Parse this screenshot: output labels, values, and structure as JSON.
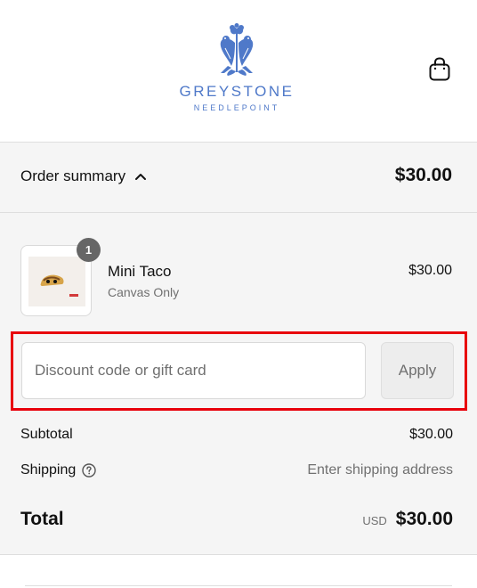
{
  "brand": {
    "name": "GREYSTONE",
    "subtitle": "NEEDLEPOINT",
    "color": "#4f79c9"
  },
  "header": {
    "cart_icon": "shopping-bag-icon"
  },
  "summary": {
    "toggle_label": "Order summary",
    "toggle_icon": "chevron-up-icon",
    "total": "$30.00"
  },
  "product": {
    "quantity": "1",
    "name": "Mini Taco",
    "variant": "Canvas Only",
    "price": "$30.00"
  },
  "discount": {
    "placeholder": "Discount code or gift card",
    "value": "",
    "apply_label": "Apply",
    "highlight_color": "#e8000b"
  },
  "totals": {
    "subtotal_label": "Subtotal",
    "subtotal_value": "$30.00",
    "shipping_label": "Shipping",
    "shipping_help_icon": "question-circle-icon",
    "shipping_value": "Enter shipping address",
    "total_label": "Total",
    "currency": "USD",
    "total_value": "$30.00"
  }
}
